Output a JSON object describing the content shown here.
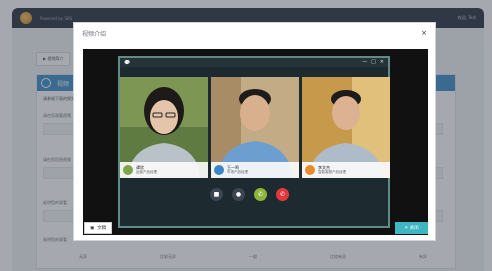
{
  "app": {
    "brand": "Powered by SBS",
    "user": "欢迎, Test",
    "toolbar_button": "▶ 视频简介",
    "panel_title": "视频",
    "panel_note": "请参阅下面的视频",
    "questions": [
      "请在您观看视频",
      "请在您回答视频",
      "谁明您的观看",
      "谁明您的观看"
    ],
    "scale": [
      "无异",
      "比较无异",
      "一般",
      "比较有异",
      "有异"
    ]
  },
  "modal": {
    "title": "视频介绍",
    "close_icon": "×",
    "chat_icon": "💬",
    "window_controls": [
      "—",
      "□",
      "×"
    ],
    "participants": [
      {
        "name": "谭欣",
        "role": "运营产品经理",
        "badge_color": "#7fa34a"
      },
      {
        "name": "王一鸣",
        "role": "市场产品经理",
        "badge_color": "#3b86c6"
      },
      {
        "name": "李文杰",
        "role": "智能客服产品经理",
        "badge_color": "#e58c2c"
      }
    ],
    "controls": [
      {
        "name": "camera",
        "color": "#3b4652",
        "glyph": "■"
      },
      {
        "name": "mic",
        "color": "#3b4652",
        "glyph": "●"
      },
      {
        "name": "answer",
        "color": "#8db53a",
        "glyph": "✆"
      },
      {
        "name": "hangup",
        "color": "#e0383e",
        "glyph": "✆"
      }
    ],
    "doc_button": "文稿",
    "ok_button": "✕ 关闭"
  }
}
